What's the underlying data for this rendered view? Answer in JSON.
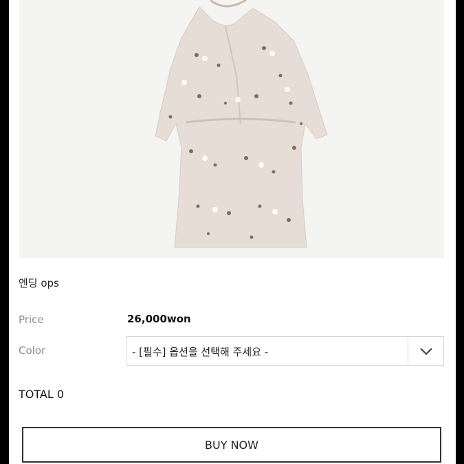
{
  "product": {
    "image_alt": "floral dress photo",
    "name": "엔딩 ops"
  },
  "price": {
    "label": "Price",
    "value": "26,000won"
  },
  "color": {
    "label": "Color",
    "selected": "- [필수] 옵션을 선택해 주세요 -"
  },
  "total": {
    "label": "TOTAL",
    "value": "0"
  },
  "actions": {
    "buy_now": "BUY NOW"
  }
}
